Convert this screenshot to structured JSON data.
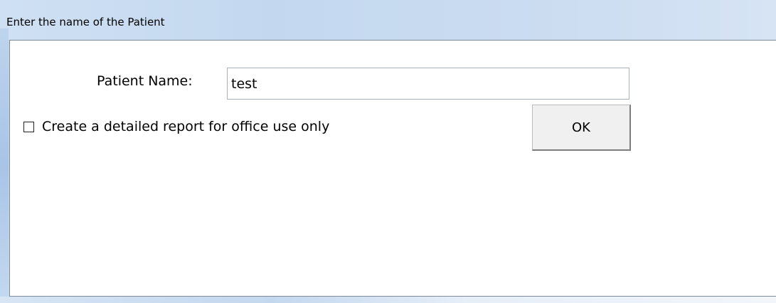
{
  "window": {
    "title": "Enter the name of the Patient"
  },
  "form": {
    "patient_name_label": "Patient Name:",
    "patient_name_value": "test",
    "detailed_report_label": "Create a detailed report for office use only",
    "detailed_report_checked": false,
    "ok_label": "OK"
  },
  "colors": {
    "titlebar": "#c3d8ef",
    "client_background": "#ffffff",
    "button_face": "#f0f0f0"
  }
}
